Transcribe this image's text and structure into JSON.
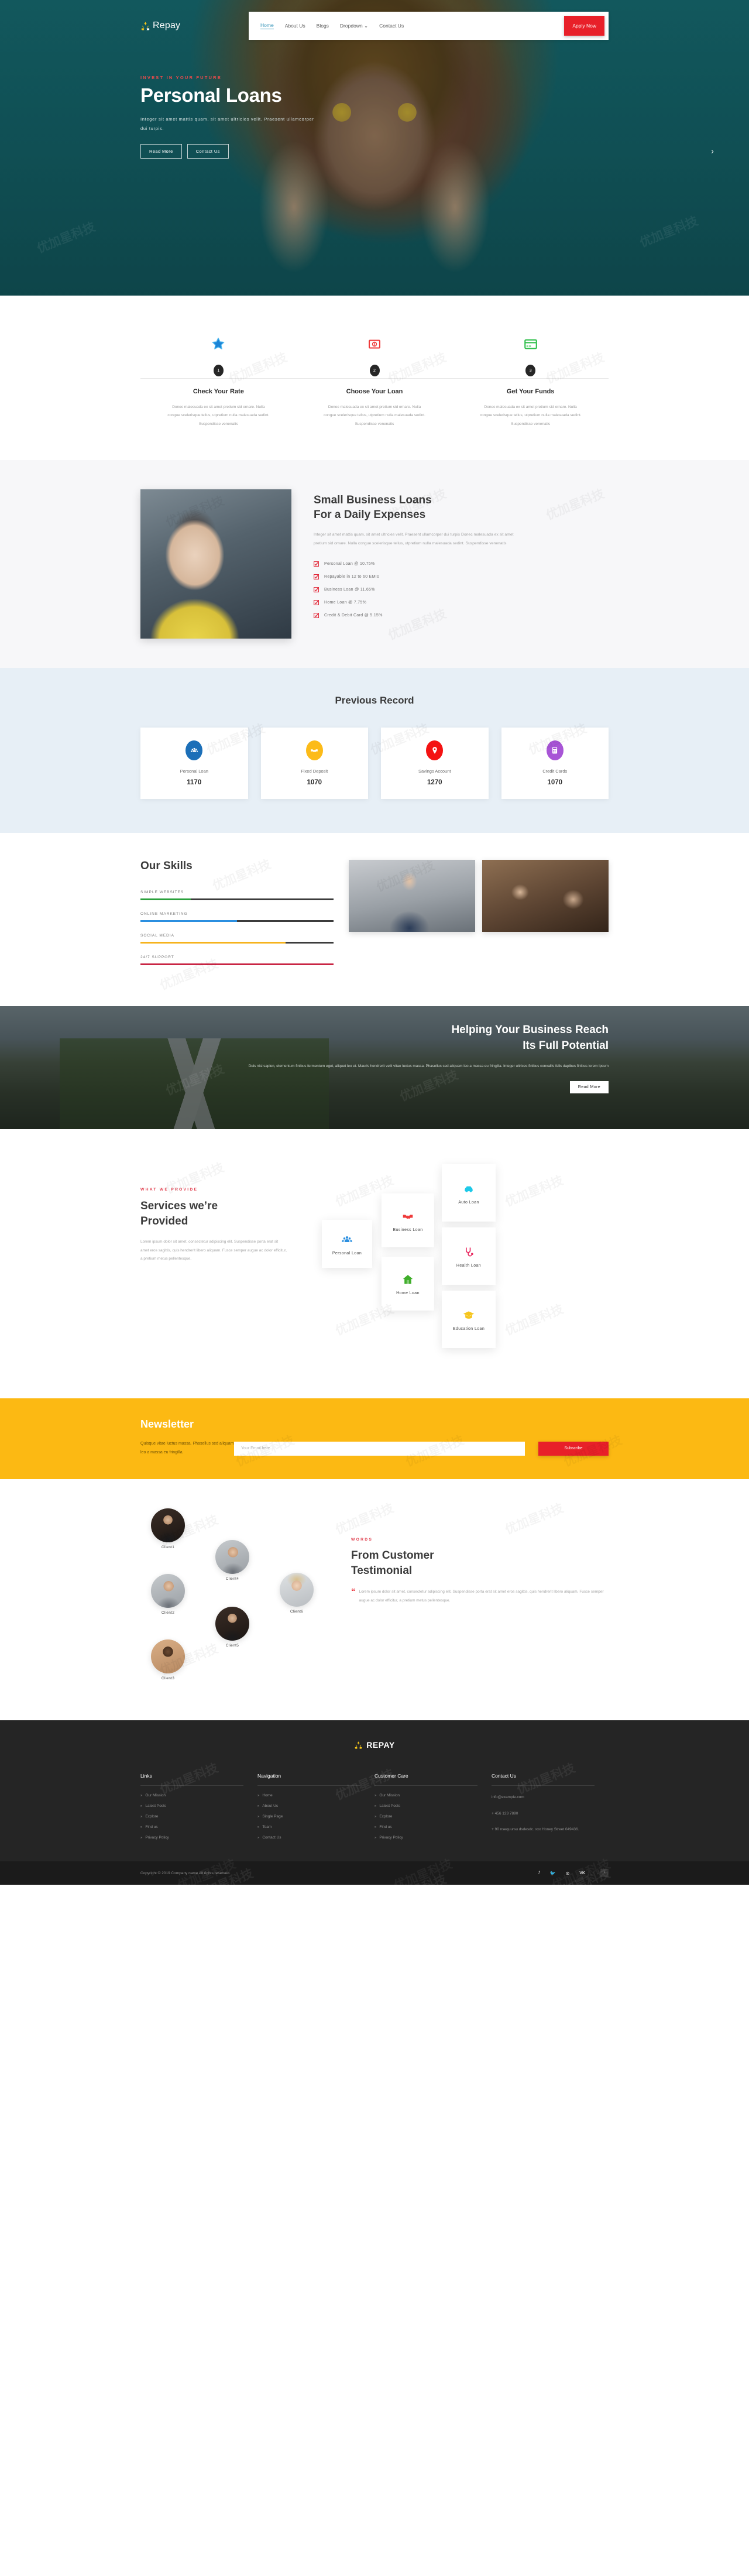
{
  "brand": {
    "name": "Repay",
    "footer_name": "REPAY"
  },
  "nav": {
    "items": [
      {
        "label": "Home",
        "active": true
      },
      {
        "label": "About Us",
        "active": false
      },
      {
        "label": "Blogs",
        "active": false
      },
      {
        "label": "Dropdown ⌄",
        "active": false
      },
      {
        "label": "Contact Us",
        "active": false
      }
    ],
    "cta": "Apply Now"
  },
  "hero": {
    "eyebrow": "INVEST IN YOUR FUTURE",
    "title": "Personal Loans",
    "subtitle": "Integer sit amet mattis quam, sit amet ultricies velit. Praesent ullamcorper dui turpis.",
    "buttons": [
      "Read More",
      "Contact Us"
    ],
    "arrow": "›"
  },
  "steps": [
    {
      "num": "1",
      "title": "Check Your Rate",
      "icon": "star-badge-icon",
      "color": "#2196f3",
      "text": "Donec malesuada ex sit amet pretium sid ornare. Nulla congue scelerisque tellus, utpretium nulla malesuada sedint. Suspendisse venenatis"
    },
    {
      "num": "2",
      "title": "Choose Your Loan",
      "icon": "money-badge-icon",
      "color": "#ef3b3b",
      "text": "Donec malesuada ex sit amet pretium sid ornare. Nulla congue scelerisque tellus, utpretium nulla malesuada sedint. Suspendisse venenatis"
    },
    {
      "num": "3",
      "title": "Get Your Funds",
      "icon": "credit-card-icon",
      "color": "#2fbf4b",
      "text": "Donec malesuada ex sit amet pretium sid ornare. Nulla congue scelerisque tellus, utpretium nulla malesuada sedint. Suspendisse venenatis"
    }
  ],
  "business": {
    "title_line1": "Small Business Loans",
    "title_line2": "For a Daily Expenses",
    "paragraph": "Integer sit amet mattis quam, sit amet ultricies velit. Praesent ullamcorper dui turpis Donec malesuada ex sit amet pretium sid ornare. Nulla congue scelerisque tellus, utpretium nulla malesuada sedint. Suspendisse venenatis",
    "items": [
      "Personal Loan @ 10.75%",
      "Repayable in 12 to 60 EMIs",
      "Business Loan @ 11.65%",
      "Home Loan @ 7.75%",
      "Credit & Debit Card @ 5.15%"
    ]
  },
  "record": {
    "title": "Previous Record",
    "cards": [
      {
        "label": "Personal Loan",
        "value": "1170",
        "icon": "people-icon",
        "color": "#1c6fb8"
      },
      {
        "label": "Fixed Deposit",
        "value": "1070",
        "icon": "handshake-icon",
        "color": "#fcbb19"
      },
      {
        "label": "Savings Account",
        "value": "1270",
        "icon": "location-icon",
        "color": "#f41212"
      },
      {
        "label": "Credit Cards",
        "value": "1070",
        "icon": "calculator-icon",
        "color": "#a855d6"
      }
    ]
  },
  "skills": {
    "title": "Our Skills",
    "bars": [
      {
        "name": "SIMPLE WEBSITES",
        "percent": 26,
        "color": "#2aa03c"
      },
      {
        "name": "ONLINE MARKETING",
        "percent": 50,
        "color": "#2b8fe0"
      },
      {
        "name": "SOCIAL MEDIA",
        "percent": 75,
        "color": "#f6b31d"
      },
      {
        "name": "24/7 SUPPORT",
        "percent": 100,
        "color": "#c92544"
      }
    ]
  },
  "potential": {
    "title_line1": "Helping Your Business Reach",
    "title_line2": "Its Full Potential",
    "paragraph": "Duis nisi sapien, elementum finibus fermentum eget, aliquet leo et. Mauris hendrerit velit vitae luctus massa. Phasellus sed aliquam leo a massa eu fringilla. Integer ultrices finibus convallis felis dapibus finibus lorem ipsum",
    "button": "Read More"
  },
  "services": {
    "eyebrow": "WHAT WE PROVIDE",
    "title_line1": "Services we’re",
    "title_line2": "Provided",
    "paragraph": "Lorem ipsum dolor sit amet, consectetur adipiscing elit. Suspendisse porta erat sit amet eros sagittis, quis hendrerit libero aliquam. Fusce semper augue ac dolor efficitur, a pretium metus pellentesque.",
    "cards": [
      {
        "label": "Personal Loan",
        "icon": "people-icon",
        "color": "#2b8fe0",
        "slot": "c-personal"
      },
      {
        "label": "Business Loan",
        "icon": "handshake-icon",
        "color": "#ef3b3b",
        "slot": "c-business"
      },
      {
        "label": "Home Loan",
        "icon": "home-icon",
        "color": "#3fae2a",
        "slot": "c-home"
      },
      {
        "label": "Auto Loan",
        "icon": "car-icon",
        "color": "#1ec9e8",
        "slot": "c-auto"
      },
      {
        "label": "Health Loan",
        "icon": "stethoscope-icon",
        "color": "#e8285f",
        "slot": "c-health"
      },
      {
        "label": "Education Loan",
        "icon": "graduation-icon",
        "color": "#f6c51d",
        "slot": "c-educ"
      }
    ]
  },
  "newsletter": {
    "title": "Newsletter",
    "copy": "Quisque vitae luctus massa. Phasellus sed aliquam leo a massa eu fringilla.",
    "placeholder": "Your Email here...",
    "button": "Subscribe"
  },
  "testimonial": {
    "eyebrow": "WORDS",
    "title_line1": "From Customer",
    "title_line2": "Testimonial",
    "quote": "Lorem ipsum dolor sit amet, consectetur adipiscing elit. Suspendisse porta erat sit amet eros sagittis, quis hendrerit libero aliquam. Fusce semper augue ac dolor efficitur, a pretium metus pellentesque.",
    "clients": [
      {
        "name": "Client1",
        "tone": "dark"
      },
      {
        "name": "Client2",
        "tone": "gray"
      },
      {
        "name": "Client3",
        "tone": "tan"
      },
      {
        "name": "Client4",
        "tone": "gray"
      },
      {
        "name": "Client5",
        "tone": "dark"
      },
      {
        "name": "Client6",
        "tone": "blond"
      }
    ]
  },
  "footer": {
    "columns": [
      {
        "heading": "Links",
        "links": [
          "Our Mission",
          "Latest Posts",
          "Explore",
          "Find us",
          "Privacy Policy"
        ]
      },
      {
        "heading": "Navigation",
        "links": [
          "Home",
          "About Us",
          "Single Page",
          "Team",
          "Contact Us"
        ]
      },
      {
        "heading": "Customer Care",
        "links": [
          "Our Mission",
          "Latest Posts",
          "Explore",
          "Find us",
          "Privacy Policy"
        ]
      }
    ],
    "contact": {
      "heading": "Contact Us",
      "email": "info@example.com",
      "phone": "+ 456 123 7890",
      "address": "+ 90 nsequursu dsdesdc. xxx Honey Street 049436."
    },
    "copyright": "Copyright © 2019 Company name All rights reserved.",
    "socials": [
      "f",
      "🐦",
      "⊛",
      "VK"
    ],
    "to_top": "⌃"
  }
}
